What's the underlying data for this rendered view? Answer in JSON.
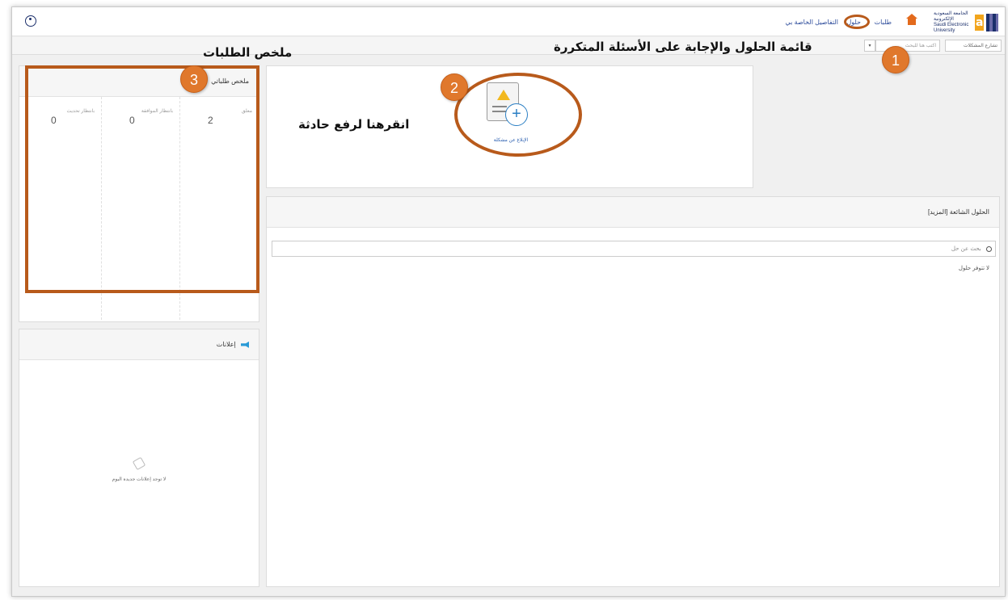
{
  "topbar": {
    "nav_requests": "طلبات",
    "nav_solutions": "حلول",
    "nav_my_details": "التفاصيل الخاصة بي",
    "logo_text_ar": "الجامعة السعودية الإلكترونية",
    "logo_text_en": "Saudi Electronic University",
    "logo_letter": "a"
  },
  "toolbar": {
    "search_placeholder": "اكتب هنا للبحث",
    "dropdown_label": "▾",
    "category_select": "تشارع المشكلات"
  },
  "annotations": {
    "faq_title": "قائمة الحلول والإجابة على الأسئلة المتكررة",
    "summary_title": "ملخص الطلبات",
    "click_hint": "انقرهنا لرفع حادثة",
    "badge_1": "1",
    "badge_2": "2",
    "badge_3": "3"
  },
  "incident_card": {
    "label": "الإبلاغ عن مشكلة"
  },
  "summary_panel": {
    "title": "ملخص طلباتي",
    "columns": [
      {
        "label": "معلق",
        "value": "2"
      },
      {
        "label": "بانتظار الموافقة",
        "value": "0"
      },
      {
        "label": "بانتظار تحديث",
        "value": "0"
      }
    ]
  },
  "announcements": {
    "title": "إعلانات",
    "empty_text": "لا توجد إعلانات جديدة اليوم"
  },
  "solutions_panel": {
    "title": "الحلول الشائعة [المزيد]",
    "search_placeholder": "بحث عن حل",
    "empty_text": "لا تتوفر حلول"
  },
  "colors": {
    "accent_orange": "#e0782c",
    "annotation_brown": "#b85a1b",
    "nav_blue": "#2b4a9a"
  }
}
